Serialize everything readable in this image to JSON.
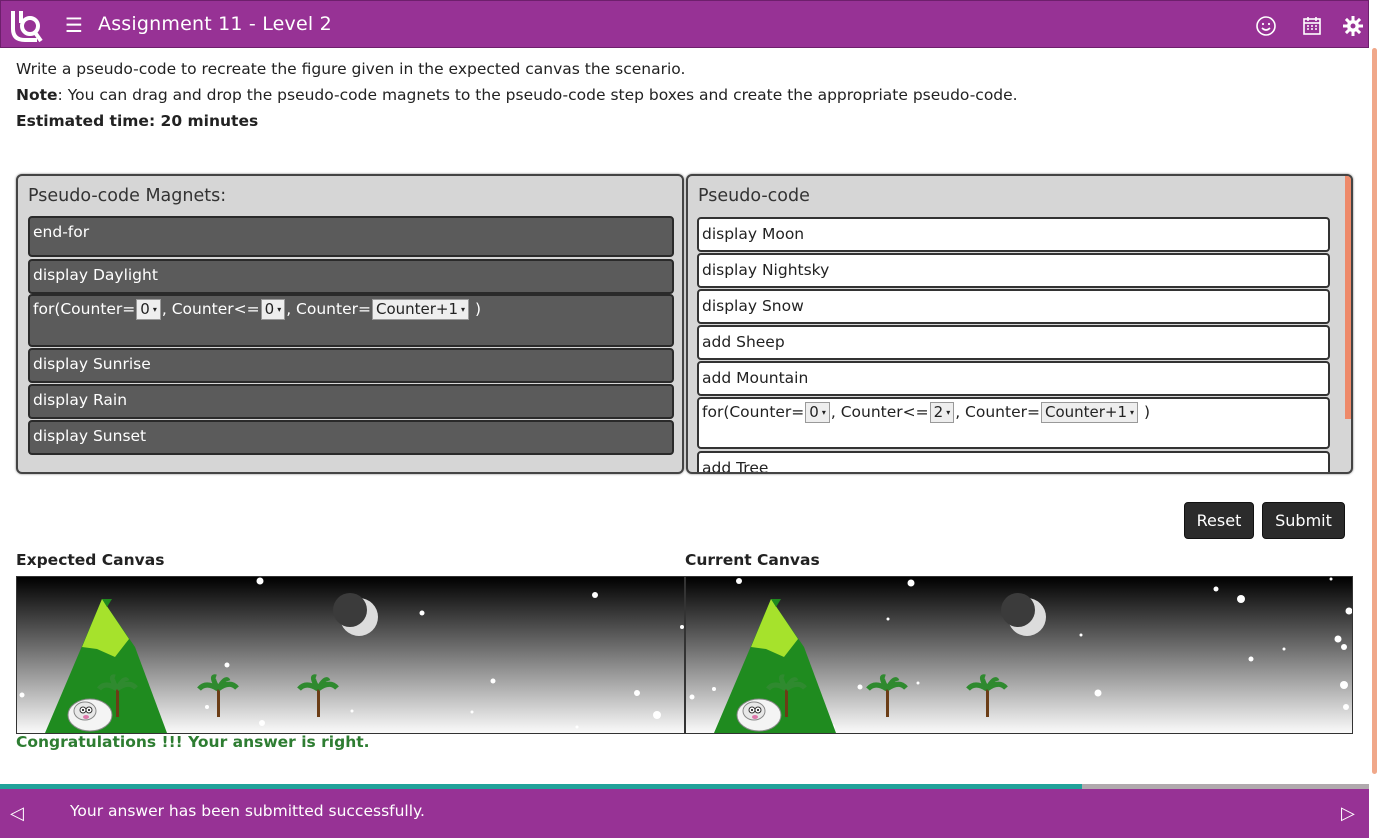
{
  "header": {
    "title": "Assignment 11 - Level 2",
    "logo_icon": "tq-logo-icon",
    "menu_icon": "hamburger-menu-icon",
    "icons": [
      "smiley-icon",
      "calendar-icon",
      "gear-icon"
    ],
    "bg_color": "#973295"
  },
  "instructions": {
    "line1": "Write a pseudo-code to recreate the figure given in the expected canvas the scenario.",
    "note_label": "Note",
    "note_text": ": You can drag and drop the pseudo-code magnets to the pseudo-code step boxes and create the appropriate pseudo-code.",
    "estimated": "Estimated time: 20 minutes"
  },
  "magnets": {
    "title": "Pseudo-code Magnets:",
    "items": [
      {
        "text": "end-for"
      },
      {
        "text": "display Daylight"
      },
      {
        "for_prefix": "for(Counter=",
        "start": "0",
        "mid": ", Counter<=",
        "end": "0",
        "mid2": ", Counter=",
        "step": "Counter+1",
        "suffix": " )"
      },
      {
        "text": "display Sunrise"
      },
      {
        "text": "display Rain"
      },
      {
        "text": "display Sunset"
      }
    ]
  },
  "pseudocode": {
    "title": "Pseudo-code",
    "steps": [
      {
        "text": "display Moon"
      },
      {
        "text": "display Nightsky"
      },
      {
        "text": "display Snow"
      },
      {
        "text": "add Sheep"
      },
      {
        "text": "add Mountain"
      },
      {
        "for_prefix": "for(Counter=",
        "start": "0",
        "mid": ", Counter<=",
        "end": "2",
        "mid2": ", Counter=",
        "step": "Counter+1",
        "suffix": " )"
      },
      {
        "text": "add Tree"
      }
    ]
  },
  "buttons": {
    "reset": "Reset",
    "submit": "Submit"
  },
  "canvases": {
    "expected_label": "Expected Canvas",
    "current_label": "Current Canvas"
  },
  "result": {
    "message": "Congratulations !!! Your answer is right.",
    "color": "#2e7d32"
  },
  "progress": {
    "fraction": 0.79,
    "fill_color": "#21a39a"
  },
  "footer": {
    "message": "Your answer has been submitted successfully.",
    "prev_icon": "triangle-left-icon",
    "next_icon": "triangle-right-icon"
  }
}
